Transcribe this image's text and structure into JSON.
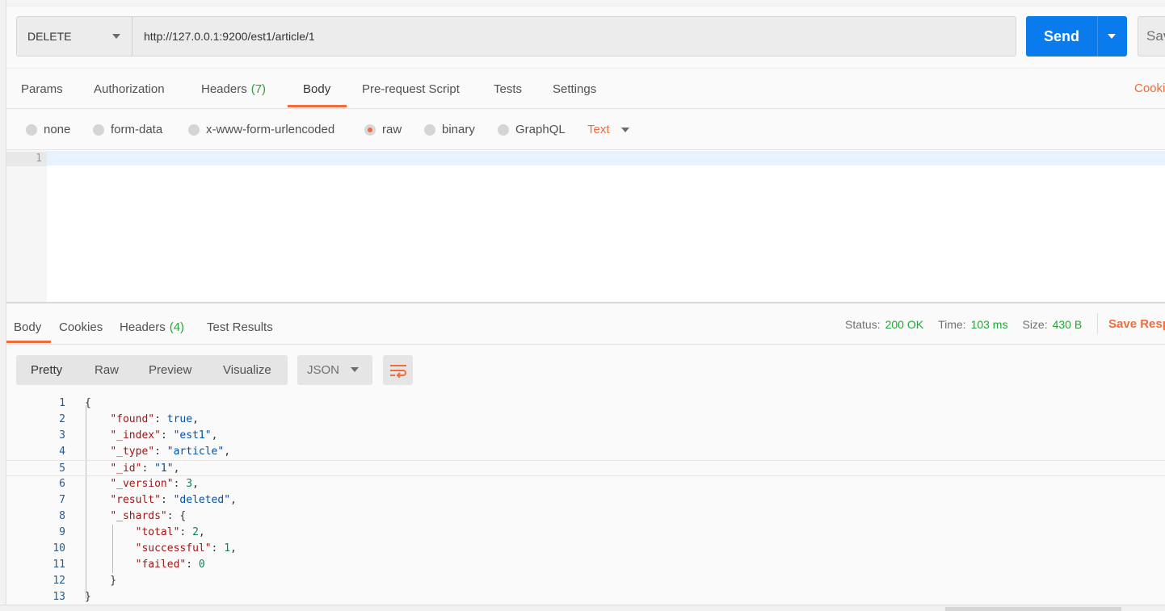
{
  "request": {
    "method": "DELETE",
    "url": "http://127.0.0.1:9200/est1/article/1",
    "send_label": "Send",
    "save_label": "Save"
  },
  "request_tabs": [
    {
      "label": "Params"
    },
    {
      "label": "Authorization"
    },
    {
      "label": "Headers",
      "count": "(7)"
    },
    {
      "label": "Body",
      "active": true
    },
    {
      "label": "Pre-request Script"
    },
    {
      "label": "Tests"
    },
    {
      "label": "Settings"
    }
  ],
  "cookies_link": "Cookies",
  "body_types": [
    {
      "label": "none"
    },
    {
      "label": "form-data"
    },
    {
      "label": "x-www-form-urlencoded"
    },
    {
      "label": "raw",
      "selected": true
    },
    {
      "label": "binary"
    },
    {
      "label": "GraphQL"
    }
  ],
  "raw_format": "Text",
  "editor": {
    "line_numbers": [
      "1"
    ]
  },
  "response_tabs": [
    {
      "label": "Body",
      "active": true
    },
    {
      "label": "Cookies"
    },
    {
      "label": "Headers",
      "count": "(4)"
    },
    {
      "label": "Test Results"
    }
  ],
  "status": {
    "status_label": "Status:",
    "status_value": "200 OK",
    "time_label": "Time:",
    "time_value": "103 ms",
    "size_label": "Size:",
    "size_value": "430 B",
    "save_response": "Save Response"
  },
  "view_modes": [
    "Pretty",
    "Raw",
    "Preview",
    "Visualize"
  ],
  "response_format": "JSON",
  "response_lines": [
    {
      "n": "1",
      "segs": [
        [
          "p",
          "{"
        ]
      ]
    },
    {
      "n": "2",
      "segs": [
        [
          "p",
          "    "
        ],
        [
          "k",
          "\"found\""
        ],
        [
          "p",
          ": "
        ],
        [
          "b",
          "true"
        ],
        [
          "p",
          ","
        ]
      ]
    },
    {
      "n": "3",
      "segs": [
        [
          "p",
          "    "
        ],
        [
          "k",
          "\"_index\""
        ],
        [
          "p",
          ": "
        ],
        [
          "s",
          "\"est1\""
        ],
        [
          "p",
          ","
        ]
      ]
    },
    {
      "n": "4",
      "segs": [
        [
          "p",
          "    "
        ],
        [
          "k",
          "\"_type\""
        ],
        [
          "p",
          ": "
        ],
        [
          "s",
          "\"article\""
        ],
        [
          "p",
          ","
        ]
      ]
    },
    {
      "n": "5",
      "segs": [
        [
          "p",
          "    "
        ],
        [
          "k",
          "\"_id\""
        ],
        [
          "p",
          ": "
        ],
        [
          "s",
          "\"1\""
        ],
        [
          "p",
          ","
        ]
      ]
    },
    {
      "n": "6",
      "segs": [
        [
          "p",
          "    "
        ],
        [
          "k",
          "\"_version\""
        ],
        [
          "p",
          ": "
        ],
        [
          "num",
          "3"
        ],
        [
          "p",
          ","
        ]
      ]
    },
    {
      "n": "7",
      "segs": [
        [
          "p",
          "    "
        ],
        [
          "k",
          "\"result\""
        ],
        [
          "p",
          ": "
        ],
        [
          "s",
          "\"deleted\""
        ],
        [
          "p",
          ","
        ]
      ]
    },
    {
      "n": "8",
      "segs": [
        [
          "p",
          "    "
        ],
        [
          "k",
          "\"_shards\""
        ],
        [
          "p",
          ": {"
        ]
      ]
    },
    {
      "n": "9",
      "segs": [
        [
          "p",
          "        "
        ],
        [
          "k",
          "\"total\""
        ],
        [
          "p",
          ": "
        ],
        [
          "num",
          "2"
        ],
        [
          "p",
          ","
        ]
      ]
    },
    {
      "n": "10",
      "segs": [
        [
          "p",
          "        "
        ],
        [
          "k",
          "\"successful\""
        ],
        [
          "p",
          ": "
        ],
        [
          "num",
          "1"
        ],
        [
          "p",
          ","
        ]
      ]
    },
    {
      "n": "11",
      "segs": [
        [
          "p",
          "        "
        ],
        [
          "k",
          "\"failed\""
        ],
        [
          "p",
          ": "
        ],
        [
          "num",
          "0"
        ]
      ]
    },
    {
      "n": "12",
      "segs": [
        [
          "p",
          "    }"
        ]
      ]
    },
    {
      "n": "13",
      "segs": [
        [
          "p",
          "}"
        ]
      ]
    }
  ],
  "colors": {
    "accent": "#f26b3a",
    "send_blue": "#097bed",
    "status_green": "#26a338"
  }
}
